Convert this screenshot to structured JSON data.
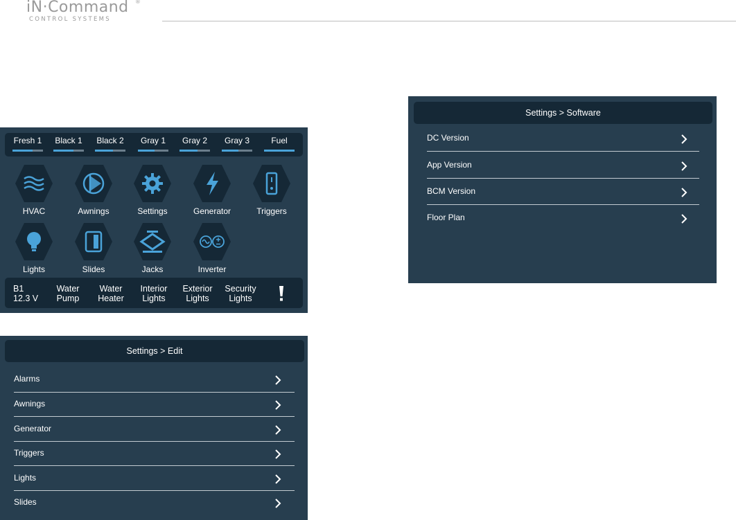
{
  "brand": {
    "name": "iN·Command",
    "reg": "®",
    "tagline": "CONTROL SYSTEMS"
  },
  "colors": {
    "panel": "#273e4f",
    "bar": "#152836",
    "accent": "#4aa3d9",
    "text": "#ffffff"
  },
  "home": {
    "tanks": [
      {
        "label": "Fresh 1",
        "level": 0.65
      },
      {
        "label": "Black 1",
        "level": 0.65
      },
      {
        "label": "Black 2",
        "level": 0.6
      },
      {
        "label": "Gray 1",
        "level": 0.55
      },
      {
        "label": "Gray 2",
        "level": 0.6
      },
      {
        "label": "Gray 3",
        "level": 0.55
      },
      {
        "label": "Fuel",
        "level": 1.0
      }
    ],
    "apps": [
      {
        "label": "HVAC",
        "icon": "hvac-waves-icon"
      },
      {
        "label": "Awnings",
        "icon": "awning-icon"
      },
      {
        "label": "Settings",
        "icon": "gear-icon"
      },
      {
        "label": "Generator",
        "icon": "lightning-bolt-icon"
      },
      {
        "label": "Triggers",
        "icon": "trigger-switch-icon"
      },
      {
        "label": "Lights",
        "icon": "light-bulb-icon"
      },
      {
        "label": "Slides",
        "icon": "slide-out-icon"
      },
      {
        "label": "Jacks",
        "icon": "jack-icon"
      },
      {
        "label": "Inverter",
        "icon": "inverter-icon"
      }
    ],
    "status": {
      "battery": {
        "name": "B1",
        "voltage": "12.3 V"
      },
      "items": [
        {
          "line1": "Water",
          "line2": "Pump"
        },
        {
          "line1": "Water",
          "line2": "Heater"
        },
        {
          "line1": "Interior",
          "line2": "Lights"
        },
        {
          "line1": "Exterior",
          "line2": "Lights"
        },
        {
          "line1": "Security",
          "line2": "Lights"
        }
      ],
      "alert_icon": "exclamation-icon"
    }
  },
  "settings_edit": {
    "title": "Settings > Edit",
    "items": [
      "Alarms",
      "Awnings",
      "Generator",
      "Triggers",
      "Lights",
      "Slides"
    ]
  },
  "settings_software": {
    "title": "Settings > Software",
    "items": [
      "DC Version",
      "App Version",
      "BCM Version",
      "Floor Plan"
    ]
  }
}
